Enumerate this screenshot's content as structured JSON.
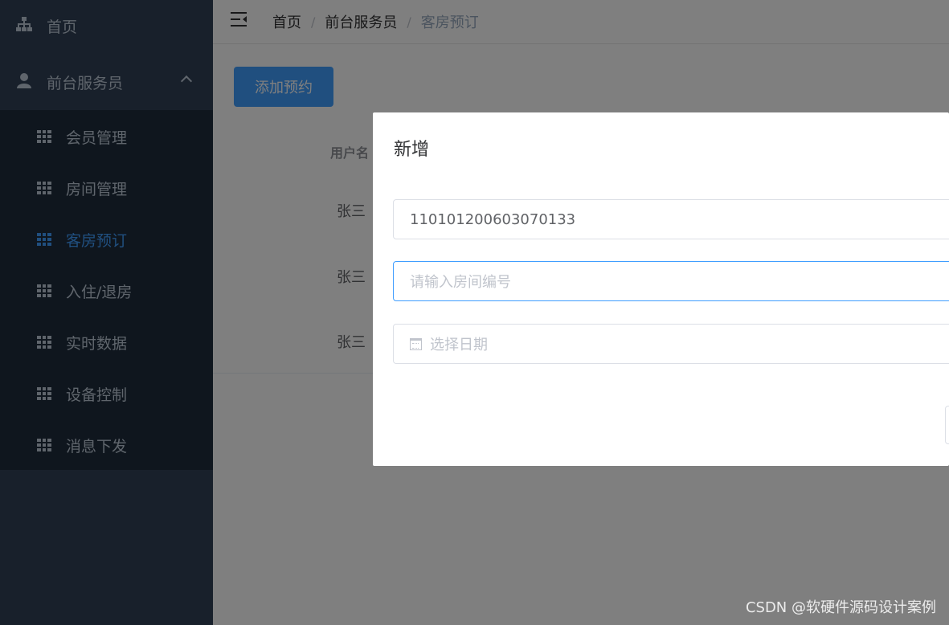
{
  "sidebar": {
    "home_label": "首页",
    "group_label": "前台服务员",
    "items": [
      {
        "label": "会员管理"
      },
      {
        "label": "房间管理"
      },
      {
        "label": "客房预订"
      },
      {
        "label": "入住/退房"
      },
      {
        "label": "实时数据"
      },
      {
        "label": "设备控制"
      },
      {
        "label": "消息下发"
      }
    ],
    "active_index": 2
  },
  "header": {
    "breadcrumb": [
      "首页",
      "前台服务员",
      "客房预订"
    ],
    "separator": "/"
  },
  "main": {
    "add_button_label": "添加预约",
    "table": {
      "columns": [
        "用户名"
      ],
      "rows": [
        [
          "张三"
        ],
        [
          "张三"
        ],
        [
          "张三"
        ]
      ]
    }
  },
  "dialog": {
    "title": "新增",
    "id_value": "110101200603070133",
    "room_placeholder": "请输入房间编号",
    "date_placeholder": "选择日期"
  },
  "watermark": "CSDN @软硬件源码设计案例",
  "colors": {
    "sidebar_bg": "#304156",
    "submenu_bg": "#1f2d3d",
    "accent": "#409eff"
  }
}
